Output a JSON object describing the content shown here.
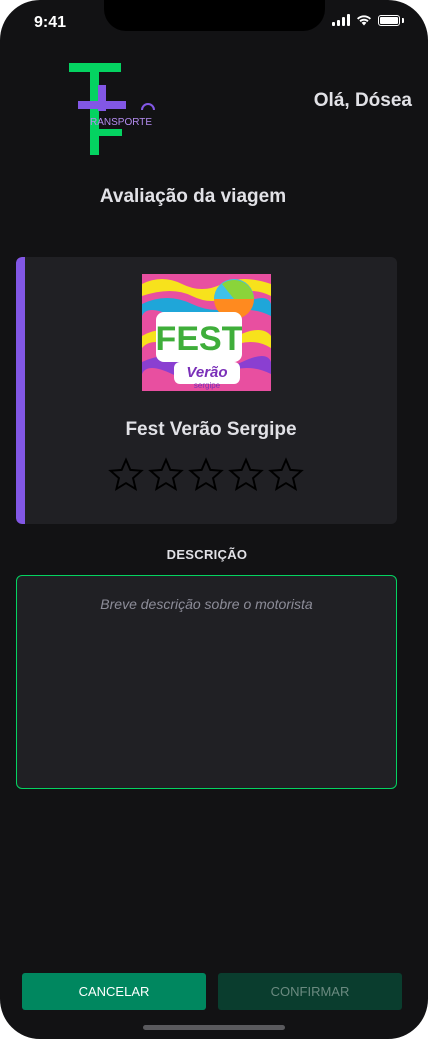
{
  "status_bar": {
    "time": "9:41"
  },
  "header": {
    "logo_text": "RANSPORTE",
    "greeting": "Olá, Dósea"
  },
  "page": {
    "title": "Avaliação da viagem"
  },
  "event": {
    "name": "Fest Verão Sergipe",
    "image_text_main": "FEST",
    "image_text_sub": "Verão",
    "image_text_small": "sergipe"
  },
  "rating": {
    "max": 5,
    "value": 0
  },
  "description": {
    "label": "DESCRIÇÃO",
    "placeholder": "Breve descrição sobre o motorista",
    "value": ""
  },
  "actions": {
    "cancel_label": "CANCELAR",
    "confirm_label": "CONFIRMAR"
  },
  "colors": {
    "accent": "#8257e5",
    "primary": "#00875f",
    "border": "#04d361",
    "background": "#121214"
  }
}
